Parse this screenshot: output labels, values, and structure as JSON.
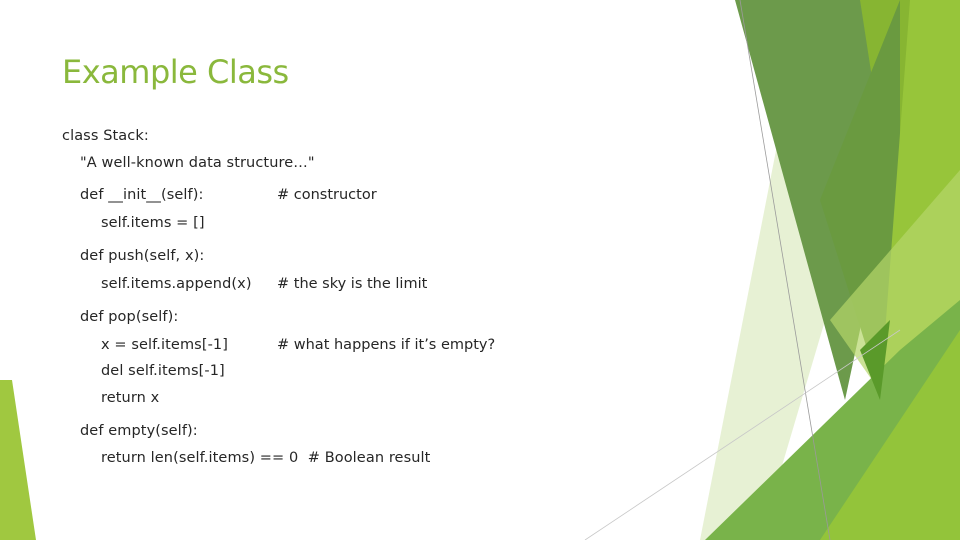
{
  "slide": {
    "title": "Example Class",
    "code": [
      {
        "text": "class Stack:",
        "indent": 0
      },
      {
        "text": "\"A well-known data structure…\"",
        "indent": 1
      },
      {
        "text": "def __init__(self):",
        "indent": 1,
        "comment": "# constructor"
      },
      {
        "text": "self.items = []",
        "indent": 2
      },
      {
        "text": "def push(self, x):",
        "indent": 1
      },
      {
        "text": "self.items.append(x)",
        "indent": 2,
        "comment": "# the sky is the limit"
      },
      {
        "text": "def pop(self):",
        "indent": 1
      },
      {
        "text": "x = self.items[-1]",
        "indent": 2,
        "comment": "# what happens if it’s empty?"
      },
      {
        "text": "del self.items[-1]",
        "indent": 2
      },
      {
        "text": "return x",
        "indent": 2
      },
      {
        "text": "def empty(self):",
        "indent": 1
      },
      {
        "text": "return len(self.items) == 0  # Boolean result",
        "indent": 2
      }
    ]
  },
  "theme": {
    "title_color": "#8ab83c",
    "text_color": "#262626",
    "accent_greens": [
      "#6c9a4b",
      "#87b532",
      "#97c53a",
      "#79b34a",
      "#d8e8b8",
      "#5a9a2a"
    ]
  }
}
